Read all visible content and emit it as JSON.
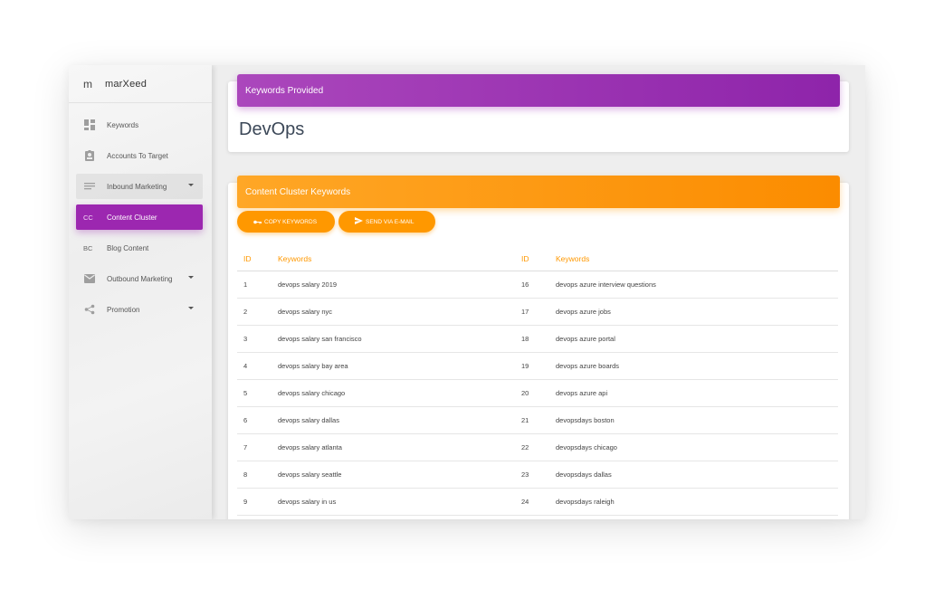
{
  "brand": {
    "mini": "m",
    "name": "marXeed"
  },
  "sidebar": {
    "items": [
      {
        "label": "Keywords",
        "icon": "dashboard-icon"
      },
      {
        "label": "Accounts To Target",
        "icon": "assignment-ind-icon"
      },
      {
        "label": "Inbound Marketing",
        "icon": "notes-icon"
      },
      {
        "abbr": "CC",
        "label": "Content Cluster"
      },
      {
        "abbr": "BC",
        "label": "Blog Content"
      },
      {
        "label": "Outbound Marketing",
        "icon": "mail-icon"
      },
      {
        "label": "Promotion",
        "icon": "share-icon"
      }
    ]
  },
  "keywords_card": {
    "title": "Keywords Provided",
    "topic": "DevOps"
  },
  "cluster_card": {
    "title": "Content Cluster Keywords",
    "copy_label": "COPY KEYWORDS",
    "email_label": "SEND VIA E-MAIL",
    "headers": [
      "ID",
      "Keywords",
      "ID",
      "Keywords"
    ],
    "rows": [
      [
        "1",
        "devops salary 2019",
        "16",
        "devops azure interview questions"
      ],
      [
        "2",
        "devops salary nyc",
        "17",
        "devops azure jobs"
      ],
      [
        "3",
        "devops salary san francisco",
        "18",
        "devops azure portal"
      ],
      [
        "4",
        "devops salary bay area",
        "19",
        "devops azure boards"
      ],
      [
        "5",
        "devops salary chicago",
        "20",
        "devops azure api"
      ],
      [
        "6",
        "devops salary dallas",
        "21",
        "devopsdays boston"
      ],
      [
        "7",
        "devops salary atlanta",
        "22",
        "devopsdays chicago"
      ],
      [
        "8",
        "devops salary seattle",
        "23",
        "devopsdays dallas"
      ],
      [
        "9",
        "devops salary in us",
        "24",
        "devopsdays raleigh"
      ]
    ]
  },
  "colors": {
    "purple": "#9c27b0",
    "orange": "#ff9800"
  }
}
